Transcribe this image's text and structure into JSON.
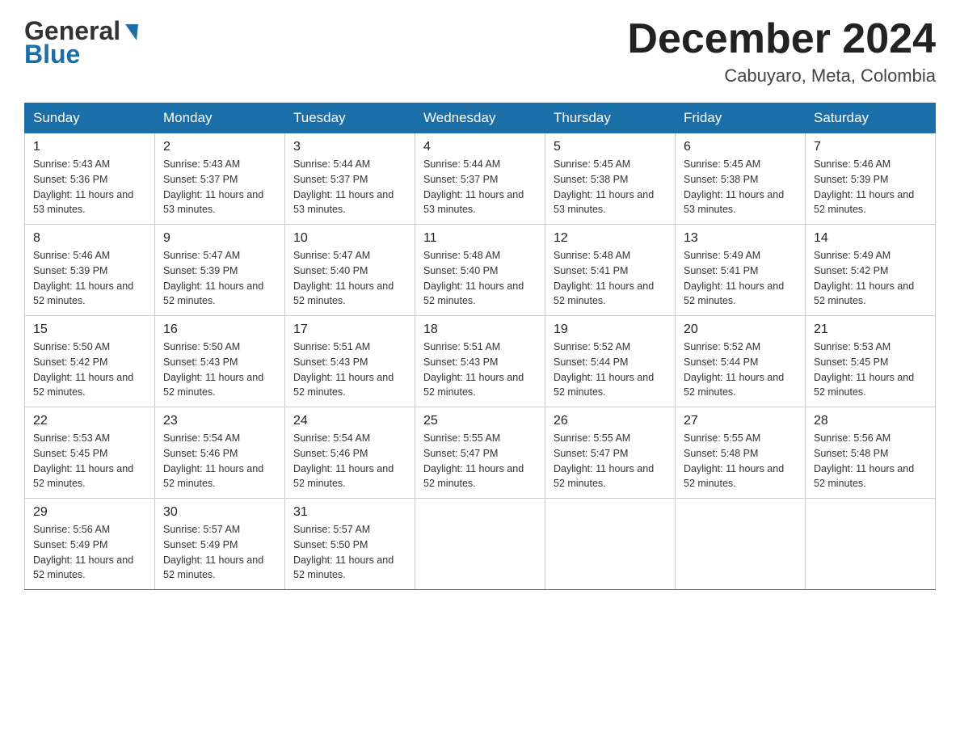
{
  "header": {
    "logo_general": "General",
    "logo_blue": "Blue",
    "month_title": "December 2024",
    "location": "Cabuyaro, Meta, Colombia"
  },
  "days_of_week": [
    "Sunday",
    "Monday",
    "Tuesday",
    "Wednesday",
    "Thursday",
    "Friday",
    "Saturday"
  ],
  "weeks": [
    [
      {
        "day": "1",
        "sunrise": "5:43 AM",
        "sunset": "5:36 PM",
        "daylight": "11 hours and 53 minutes."
      },
      {
        "day": "2",
        "sunrise": "5:43 AM",
        "sunset": "5:37 PM",
        "daylight": "11 hours and 53 minutes."
      },
      {
        "day": "3",
        "sunrise": "5:44 AM",
        "sunset": "5:37 PM",
        "daylight": "11 hours and 53 minutes."
      },
      {
        "day": "4",
        "sunrise": "5:44 AM",
        "sunset": "5:37 PM",
        "daylight": "11 hours and 53 minutes."
      },
      {
        "day": "5",
        "sunrise": "5:45 AM",
        "sunset": "5:38 PM",
        "daylight": "11 hours and 53 minutes."
      },
      {
        "day": "6",
        "sunrise": "5:45 AM",
        "sunset": "5:38 PM",
        "daylight": "11 hours and 53 minutes."
      },
      {
        "day": "7",
        "sunrise": "5:46 AM",
        "sunset": "5:39 PM",
        "daylight": "11 hours and 52 minutes."
      }
    ],
    [
      {
        "day": "8",
        "sunrise": "5:46 AM",
        "sunset": "5:39 PM",
        "daylight": "11 hours and 52 minutes."
      },
      {
        "day": "9",
        "sunrise": "5:47 AM",
        "sunset": "5:39 PM",
        "daylight": "11 hours and 52 minutes."
      },
      {
        "day": "10",
        "sunrise": "5:47 AM",
        "sunset": "5:40 PM",
        "daylight": "11 hours and 52 minutes."
      },
      {
        "day": "11",
        "sunrise": "5:48 AM",
        "sunset": "5:40 PM",
        "daylight": "11 hours and 52 minutes."
      },
      {
        "day": "12",
        "sunrise": "5:48 AM",
        "sunset": "5:41 PM",
        "daylight": "11 hours and 52 minutes."
      },
      {
        "day": "13",
        "sunrise": "5:49 AM",
        "sunset": "5:41 PM",
        "daylight": "11 hours and 52 minutes."
      },
      {
        "day": "14",
        "sunrise": "5:49 AM",
        "sunset": "5:42 PM",
        "daylight": "11 hours and 52 minutes."
      }
    ],
    [
      {
        "day": "15",
        "sunrise": "5:50 AM",
        "sunset": "5:42 PM",
        "daylight": "11 hours and 52 minutes."
      },
      {
        "day": "16",
        "sunrise": "5:50 AM",
        "sunset": "5:43 PM",
        "daylight": "11 hours and 52 minutes."
      },
      {
        "day": "17",
        "sunrise": "5:51 AM",
        "sunset": "5:43 PM",
        "daylight": "11 hours and 52 minutes."
      },
      {
        "day": "18",
        "sunrise": "5:51 AM",
        "sunset": "5:43 PM",
        "daylight": "11 hours and 52 minutes."
      },
      {
        "day": "19",
        "sunrise": "5:52 AM",
        "sunset": "5:44 PM",
        "daylight": "11 hours and 52 minutes."
      },
      {
        "day": "20",
        "sunrise": "5:52 AM",
        "sunset": "5:44 PM",
        "daylight": "11 hours and 52 minutes."
      },
      {
        "day": "21",
        "sunrise": "5:53 AM",
        "sunset": "5:45 PM",
        "daylight": "11 hours and 52 minutes."
      }
    ],
    [
      {
        "day": "22",
        "sunrise": "5:53 AM",
        "sunset": "5:45 PM",
        "daylight": "11 hours and 52 minutes."
      },
      {
        "day": "23",
        "sunrise": "5:54 AM",
        "sunset": "5:46 PM",
        "daylight": "11 hours and 52 minutes."
      },
      {
        "day": "24",
        "sunrise": "5:54 AM",
        "sunset": "5:46 PM",
        "daylight": "11 hours and 52 minutes."
      },
      {
        "day": "25",
        "sunrise": "5:55 AM",
        "sunset": "5:47 PM",
        "daylight": "11 hours and 52 minutes."
      },
      {
        "day": "26",
        "sunrise": "5:55 AM",
        "sunset": "5:47 PM",
        "daylight": "11 hours and 52 minutes."
      },
      {
        "day": "27",
        "sunrise": "5:55 AM",
        "sunset": "5:48 PM",
        "daylight": "11 hours and 52 minutes."
      },
      {
        "day": "28",
        "sunrise": "5:56 AM",
        "sunset": "5:48 PM",
        "daylight": "11 hours and 52 minutes."
      }
    ],
    [
      {
        "day": "29",
        "sunrise": "5:56 AM",
        "sunset": "5:49 PM",
        "daylight": "11 hours and 52 minutes."
      },
      {
        "day": "30",
        "sunrise": "5:57 AM",
        "sunset": "5:49 PM",
        "daylight": "11 hours and 52 minutes."
      },
      {
        "day": "31",
        "sunrise": "5:57 AM",
        "sunset": "5:50 PM",
        "daylight": "11 hours and 52 minutes."
      },
      null,
      null,
      null,
      null
    ]
  ]
}
